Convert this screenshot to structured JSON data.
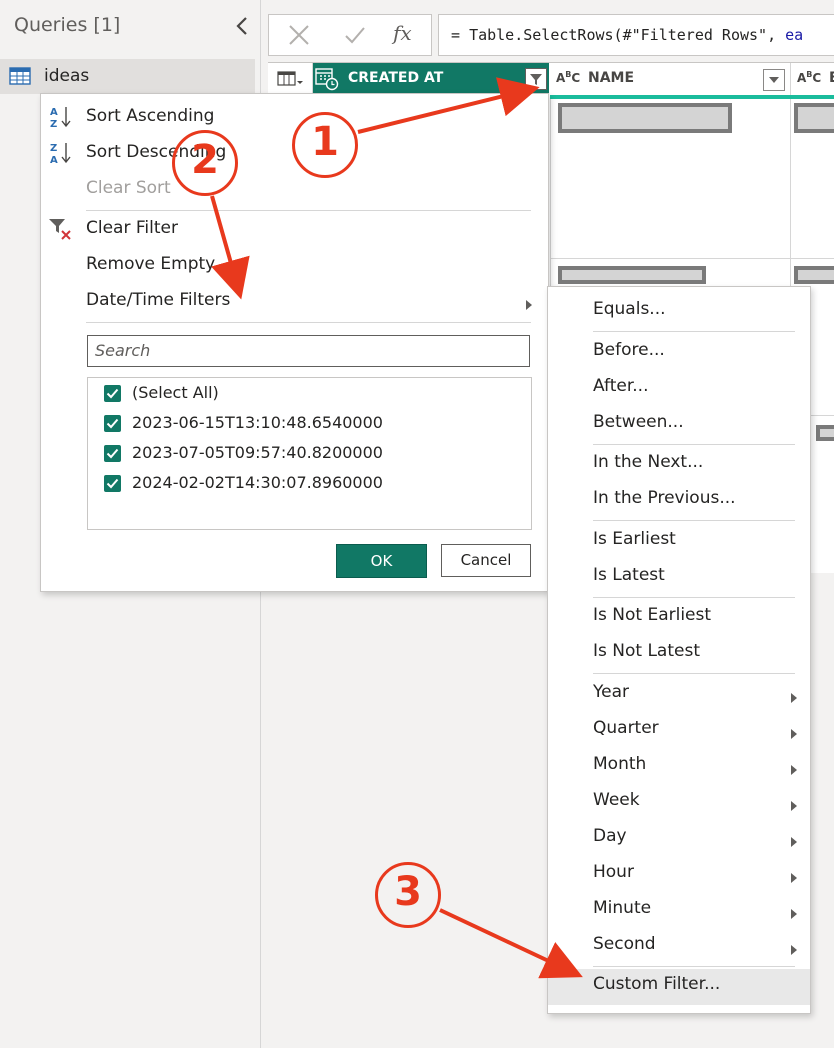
{
  "queries": {
    "title": "Queries [1]",
    "items": [
      {
        "label": "ideas"
      }
    ]
  },
  "formula": {
    "prefix": "= ",
    "code": "Table.SelectRows(#\"Filtered Rows\", ",
    "code_tail": "ea"
  },
  "columns": [
    {
      "label": "CREATED AT",
      "type_icon": "datetime-type-icon"
    },
    {
      "label": "NAME",
      "type_icon": "text-type-icon"
    },
    {
      "label": "E",
      "type_icon": "text-type-icon"
    }
  ],
  "filter_menu": {
    "sort_ascending": "Sort Ascending",
    "sort_descending": "Sort Descending",
    "clear_sort": "Clear Sort",
    "clear_filter": "Clear Filter",
    "remove_empty": "Remove Empty",
    "datetime_filters": "Date/Time Filters",
    "search_placeholder": "Search",
    "values": [
      {
        "label": "(Select All)",
        "checked": true
      },
      {
        "label": "2023-06-15T13:10:48.6540000",
        "checked": true
      },
      {
        "label": "2023-07-05T09:57:40.8200000",
        "checked": true
      },
      {
        "label": "2024-02-02T14:30:07.8960000",
        "checked": true
      }
    ],
    "ok": "OK",
    "cancel": "Cancel"
  },
  "submenu": {
    "items": [
      {
        "label": "Equals...",
        "has_submenu": false
      },
      {
        "label": "Before...",
        "has_submenu": false
      },
      {
        "label": "After...",
        "has_submenu": false
      },
      {
        "label": "Between...",
        "has_submenu": false
      },
      {
        "label": "In the Next...",
        "has_submenu": false
      },
      {
        "label": "In the Previous...",
        "has_submenu": false
      },
      {
        "label": "Is Earliest",
        "has_submenu": false
      },
      {
        "label": "Is Latest",
        "has_submenu": false
      },
      {
        "label": "Is Not Earliest",
        "has_submenu": false
      },
      {
        "label": "Is Not Latest",
        "has_submenu": false
      },
      {
        "label": "Year",
        "has_submenu": true
      },
      {
        "label": "Quarter",
        "has_submenu": true
      },
      {
        "label": "Month",
        "has_submenu": true
      },
      {
        "label": "Week",
        "has_submenu": true
      },
      {
        "label": "Day",
        "has_submenu": true
      },
      {
        "label": "Hour",
        "has_submenu": true
      },
      {
        "label": "Minute",
        "has_submenu": true
      },
      {
        "label": "Second",
        "has_submenu": true
      },
      {
        "label": "Custom Filter...",
        "has_submenu": false,
        "highlighted": true
      }
    ]
  },
  "annotations": {
    "step1": "1",
    "step2": "2",
    "step3": "3",
    "color": "#e8391d"
  },
  "colors": {
    "accent": "#117865",
    "column_highlight": "#1abc9c"
  }
}
